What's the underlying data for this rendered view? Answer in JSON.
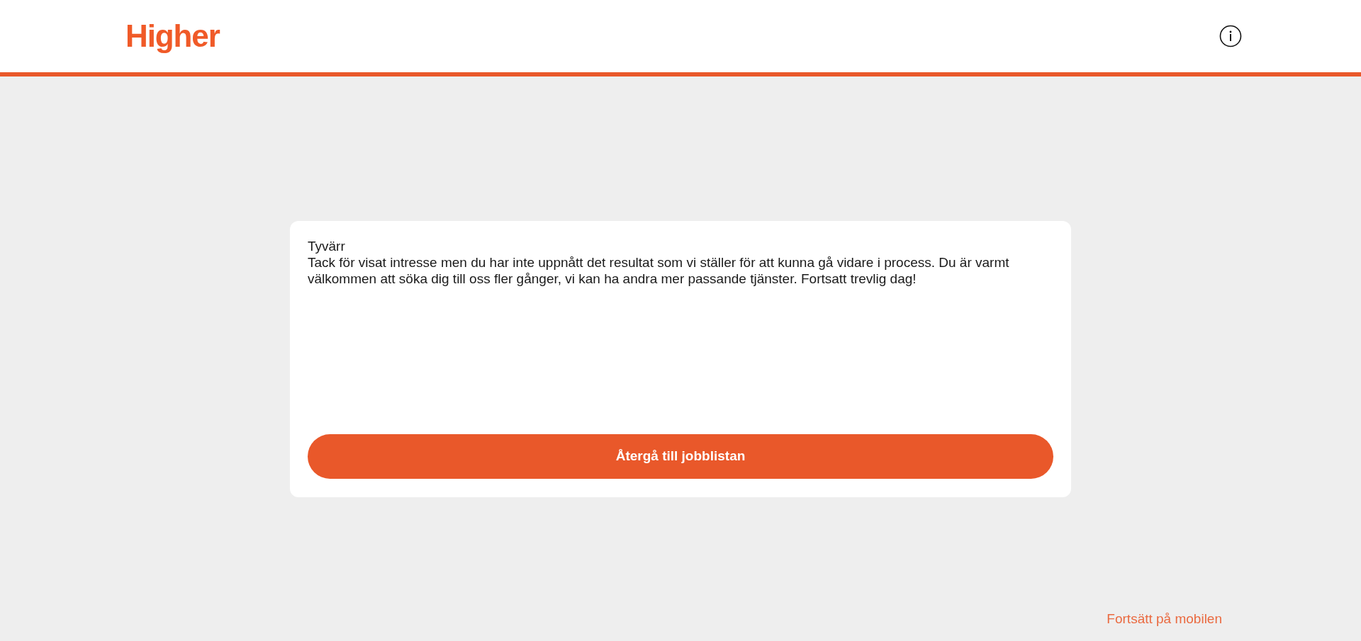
{
  "header": {
    "logo": "Higher"
  },
  "card": {
    "title": "Tyvärr",
    "message": "Tack för visat intresse men du har inte uppnått det resultat som vi ställer för att kunna gå vidare i process. Du är varmt välkommen att söka dig till oss fler gånger, vi kan ha andra mer passande tjänster. Fortsatt trevlig dag!",
    "button": "Återgå till jobblistan"
  },
  "footer_link": "Fortsätt på mobilen"
}
